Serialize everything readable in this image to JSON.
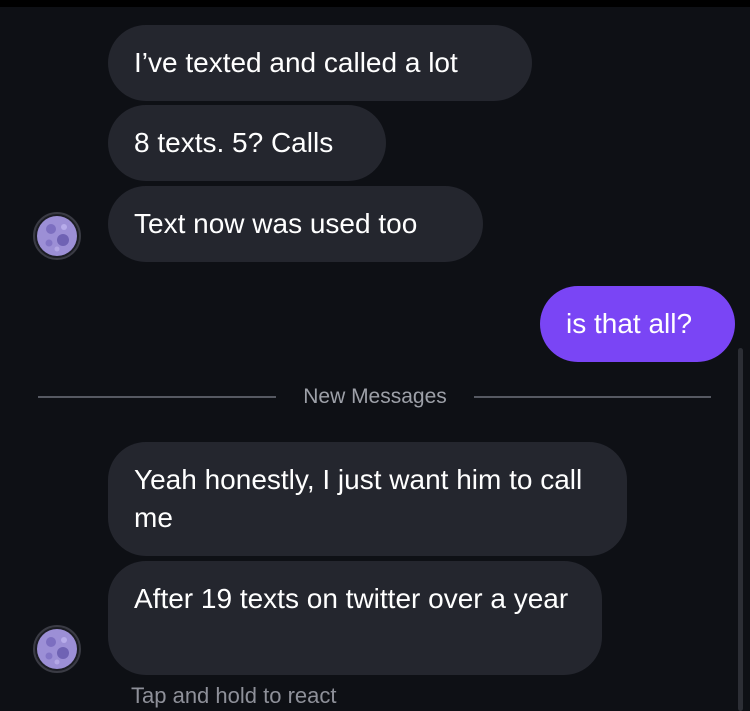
{
  "conversation": {
    "messages_before": [
      {
        "text": "I’ve texted and called a lot",
        "direction": "received"
      },
      {
        "text": "8 texts. 5? Calls",
        "direction": "received"
      },
      {
        "text": "Text now was used too",
        "direction": "received"
      }
    ],
    "sent_message": {
      "text": "is that all?",
      "direction": "sent"
    },
    "new_messages_divider": "New Messages",
    "messages_after": [
      {
        "text": "Yeah honestly, I just want him to call me",
        "direction": "received"
      },
      {
        "text": "After 19 texts on twitter over a year",
        "direction": "received"
      }
    ],
    "react_hint": "Tap and hold to react"
  },
  "avatar": {
    "icon": "moon-icon"
  },
  "colors": {
    "background": "#0e1015",
    "received_bubble": "#24262e",
    "sent_bubble": "#7a45f5",
    "text": "#ffffff",
    "secondary_text": "#9da0a8"
  }
}
